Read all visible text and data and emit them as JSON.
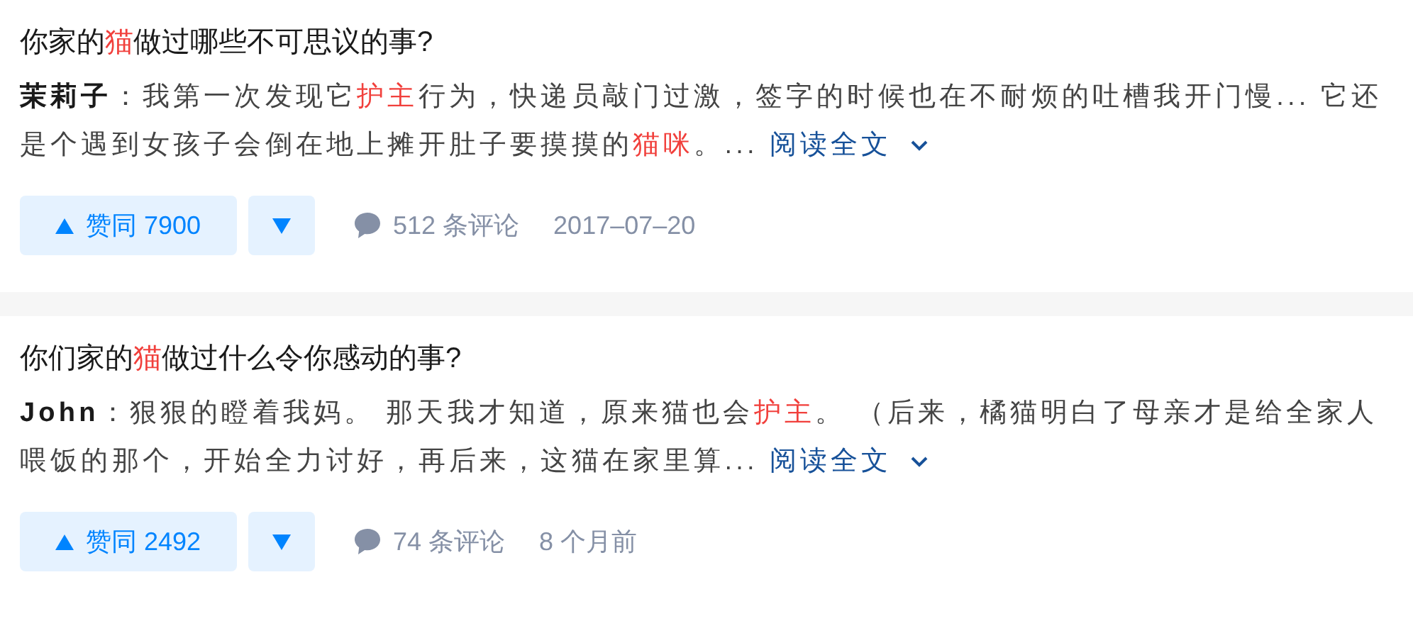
{
  "results": [
    {
      "title": [
        {
          "text": "你家的",
          "highlight": false
        },
        {
          "text": "猫",
          "highlight": true
        },
        {
          "text": "做过哪些不可思议的事?",
          "highlight": false
        }
      ],
      "excerpt": [
        {
          "text": "茉莉子",
          "kind": "author"
        },
        {
          "text": "：我第一次发现它",
          "kind": "plain"
        },
        {
          "text": "护主",
          "kind": "highlight"
        },
        {
          "text": "行为，快递员敲门过激，签字的时候也在不耐烦的吐槽我开门慢... 它还是个遇到女孩子会倒在地上摊开肚子要摸摸的",
          "kind": "plain"
        },
        {
          "text": "猫咪",
          "kind": "highlight"
        },
        {
          "text": "。...",
          "kind": "plain"
        }
      ],
      "read_more": "阅读全文",
      "upvote": "赞同 7900",
      "comments": "512 条评论",
      "date": "2017–07–20"
    },
    {
      "title": [
        {
          "text": "你们家的",
          "highlight": false
        },
        {
          "text": "猫",
          "highlight": true
        },
        {
          "text": "做过什么令你感动的事?",
          "highlight": false
        }
      ],
      "excerpt": [
        {
          "text": "John",
          "kind": "author"
        },
        {
          "text": "：狠狠的瞪着我妈。 那天我才知道，原来猫也会",
          "kind": "plain"
        },
        {
          "text": "护主",
          "kind": "highlight"
        },
        {
          "text": "。 （后来，橘猫明白了母亲才是给全家人喂饭的那个，开始全力讨好，再后来，这猫在家里算...",
          "kind": "plain"
        }
      ],
      "read_more": "阅读全文",
      "upvote": "赞同 2492",
      "comments": "74 条评论",
      "date": "8 个月前"
    }
  ]
}
